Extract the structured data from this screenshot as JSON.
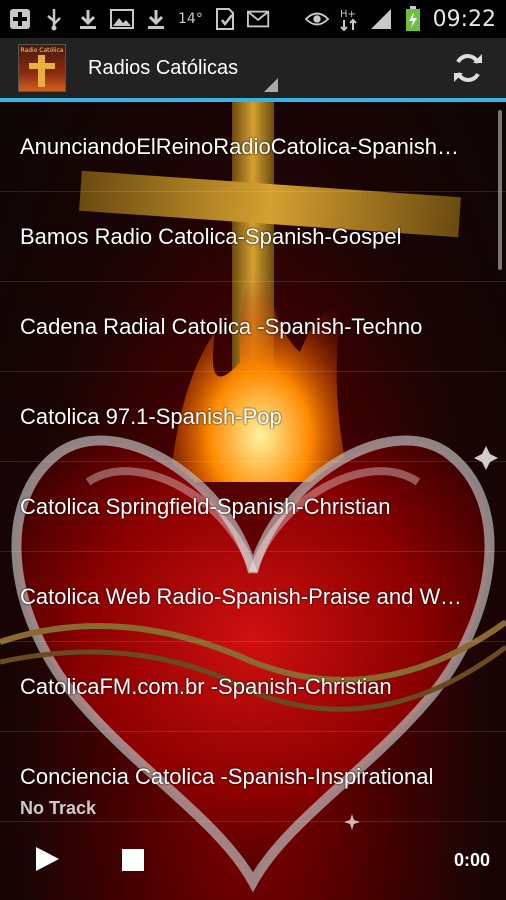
{
  "status_bar": {
    "temperature": "14°",
    "time": "09:22",
    "icons": [
      "add-icon",
      "usb-icon",
      "download-icon",
      "image-icon",
      "download-icon",
      "sd-card-icon",
      "email-icon",
      "eye-icon",
      "network-hplus-icon",
      "signal-icon",
      "battery-charging-icon"
    ]
  },
  "action_bar": {
    "app_icon_text": "Radio Católica",
    "title": "Radios Católicas",
    "refresh_icon": "refresh-icon"
  },
  "stations": [
    {
      "label": "AnunciandoElReinoRadioCatolica-Spanish-Religious"
    },
    {
      "label": "Bamos Radio Catolica-Spanish-Gospel"
    },
    {
      "label": "Cadena Radial Catolica -Spanish-Techno"
    },
    {
      "label": "Catolica 97.1-Spanish-Pop"
    },
    {
      "label": "Catolica Springfield-Spanish-Christian"
    },
    {
      "label": "Catolica Web Radio-Spanish-Praise and Worship"
    },
    {
      "label": "CatolicaFM.com.br -Spanish-Christian"
    },
    {
      "label": "Conciencia Catolica -Spanish-Inspirational"
    }
  ],
  "player": {
    "track": "No Track",
    "time": "0:00",
    "play_icon": "play-icon",
    "stop_icon": "stop-icon"
  },
  "colors": {
    "accent": "#33b5e5",
    "action_bar": "#222222",
    "background_red": "#8a0000"
  }
}
